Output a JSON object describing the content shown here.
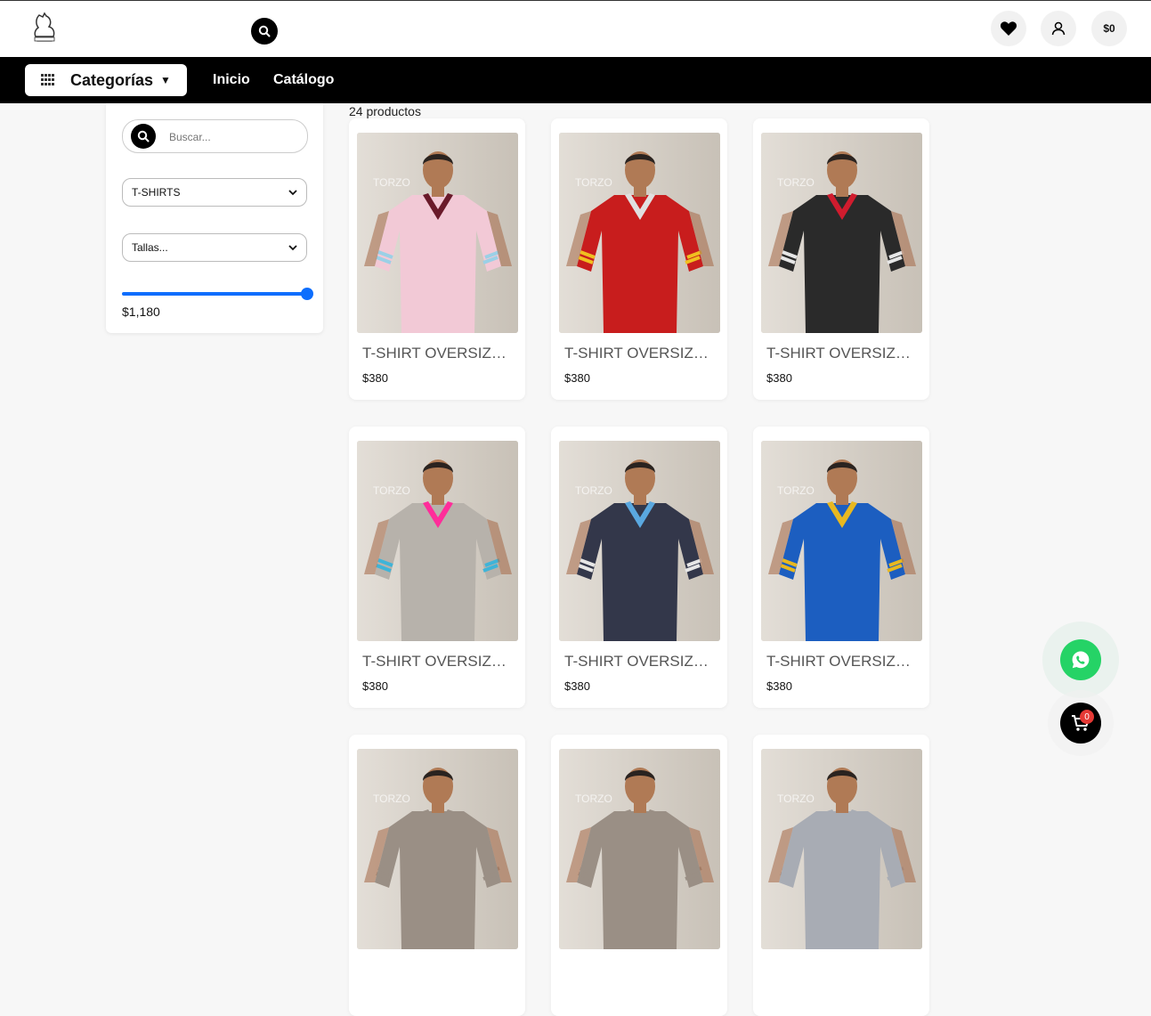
{
  "header": {
    "cart_total": "$0",
    "logo_icon": "torzo-logo",
    "search_icon": "search-icon",
    "wishlist_icon": "heart-icon",
    "account_icon": "user-icon"
  },
  "nav": {
    "categories_label": "Categorías",
    "categories_caret": "▼",
    "links": [
      "Inicio",
      "Catálogo"
    ]
  },
  "filters": {
    "search_placeholder": "Buscar...",
    "category_selected": "T-SHIRTS",
    "size_selected": "Tallas...",
    "price_max_label": "$1,180",
    "price_range_fraction": 1.0
  },
  "catalog": {
    "count_label": "24 productos",
    "products": [
      {
        "name": "T-SHIRT OVERSIZE MESH ROSA",
        "price": "$380",
        "shirt": "#f2c9d6",
        "collar": "#6a1a2a",
        "stripe": "#9bd0e6"
      },
      {
        "name": "T-SHIRT OVERSIZE MESH ROJA",
        "price": "$380",
        "shirt": "#c81d1d",
        "collar": "#e0e0e0",
        "stripe": "#f0c020"
      },
      {
        "name": "T-SHIRT OVERSIZE MESH NEGRA",
        "price": "$380",
        "shirt": "#2a2a2a",
        "collar": "#d01c2e",
        "stripe": "#e6e6e6"
      },
      {
        "name": "T-SHIRT OVERSIZE MESH GRIS",
        "price": "$380",
        "shirt": "#b7b2ab",
        "collar": "#ff2d9a",
        "stripe": "#3fb4d8"
      },
      {
        "name": "T-SHIRT OVERSIZE MESH MARINO",
        "price": "$380",
        "shirt": "#33374a",
        "collar": "#5aa8e0",
        "stripe": "#e6e6e6"
      },
      {
        "name": "T-SHIRT OVERSIZE MESH AZUL",
        "price": "$380",
        "shirt": "#1c5ec0",
        "collar": "#e8b820",
        "stripe": "#e8b820"
      },
      {
        "name": "",
        "price": "",
        "shirt": "#9a8f85",
        "collar": "#9a8f85",
        "stripe": "#9a8f85"
      },
      {
        "name": "",
        "price": "",
        "shirt": "#9a8f85",
        "collar": "#9a8f85",
        "stripe": "#9a8f85"
      },
      {
        "name": "",
        "price": "",
        "shirt": "#a8acb4",
        "collar": "#a8acb4",
        "stripe": "#a8acb4"
      }
    ]
  },
  "floating": {
    "whatsapp_icon": "whatsapp-icon",
    "cart_icon": "cart-icon",
    "cart_count": "0"
  },
  "colors": {
    "nav_bg": "#000000",
    "accent": "#0d6efd",
    "whatsapp": "#25d366",
    "badge": "#e53935"
  }
}
